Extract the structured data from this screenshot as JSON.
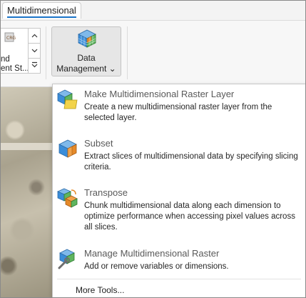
{
  "tab": {
    "label": "Multidimensional"
  },
  "gallery": {
    "label_line1": "nd",
    "label_line2": "ent St..."
  },
  "data_management": {
    "label_line1": "Data",
    "label_line2": "Management",
    "chevron": "⌄"
  },
  "menu": {
    "items": [
      {
        "title": "Make Multidimensional Raster Layer",
        "description": "Create a new multidimensional raster layer from the selected layer."
      },
      {
        "title": "Subset",
        "description": "Extract slices of multidimensional data by specifying slicing criteria."
      },
      {
        "title": "Transpose",
        "description": "Chunk multidimensional data along each dimension to optimize performance when accessing pixel values across all slices."
      },
      {
        "title": "Manage Multidimensional Raster",
        "description": "Add or remove variables or dimensions."
      }
    ],
    "more_tools": "More Tools..."
  },
  "icons": [
    "cube-icon",
    "layer-cube-icon",
    "subset-cube-icon",
    "transpose-cube-icon",
    "manage-cube-icon"
  ],
  "colors": {
    "accent": "#1a73c8",
    "cube_blue": "#3a8dd9",
    "cube_green": "#5fb55f",
    "cube_orange": "#e58a2a",
    "folder_yellow": "#f2d34b"
  }
}
